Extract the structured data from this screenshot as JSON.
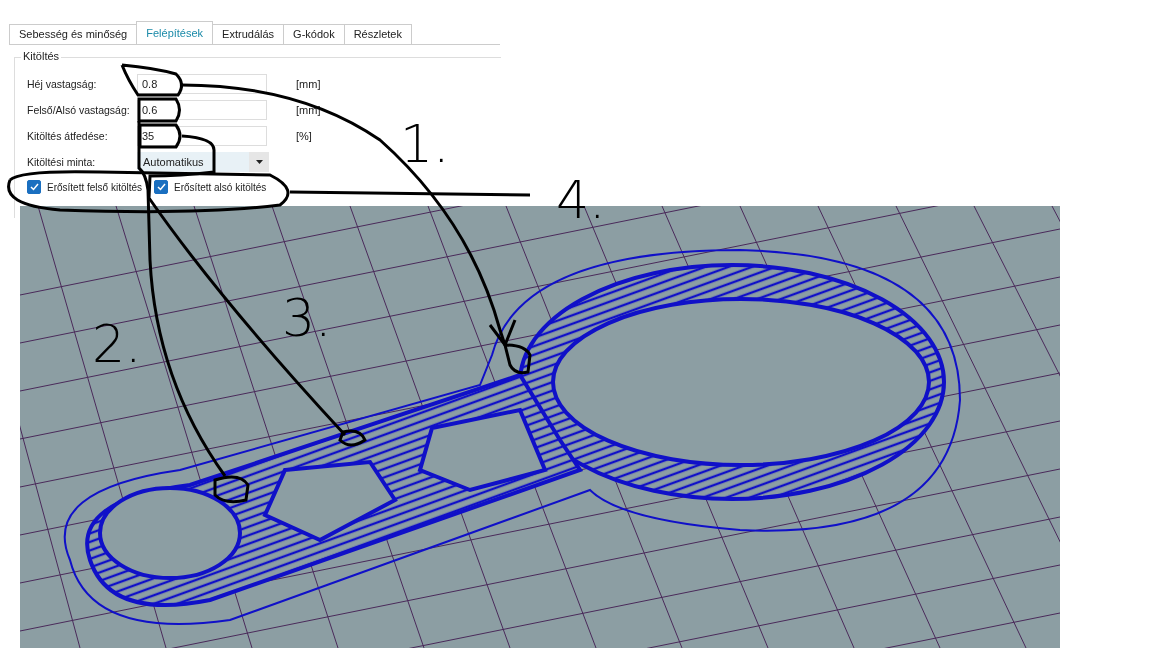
{
  "tabs": [
    {
      "label": "Sebesség és minőség",
      "selected": false
    },
    {
      "label": "Felépítések",
      "selected": true
    },
    {
      "label": "Extrudálás",
      "selected": false
    },
    {
      "label": "G-kódok",
      "selected": false
    },
    {
      "label": "Részletek",
      "selected": false
    }
  ],
  "group": {
    "title": "Kitöltés",
    "fields": [
      {
        "kind": "input",
        "label": "Héj vastagság:",
        "value": "0.8",
        "unit": "[mm]"
      },
      {
        "kind": "input",
        "label": "Felső/Alsó vastagság:",
        "value": "0.6",
        "unit": "[mm]"
      },
      {
        "kind": "input",
        "label": "Kitöltés átfedése:",
        "value": "35",
        "unit": "[%]"
      },
      {
        "kind": "dropdown",
        "label": "Kitöltési minta:",
        "value": "Automatikus"
      }
    ],
    "checkboxes": [
      {
        "label": "Erősített felső kitöltés",
        "checked": true
      },
      {
        "label": "Erősített alsó kitöltés",
        "checked": true
      }
    ]
  },
  "annotations": [
    {
      "label": "1."
    },
    {
      "label": "2."
    },
    {
      "label": "3."
    },
    {
      "label": "4."
    }
  ]
}
